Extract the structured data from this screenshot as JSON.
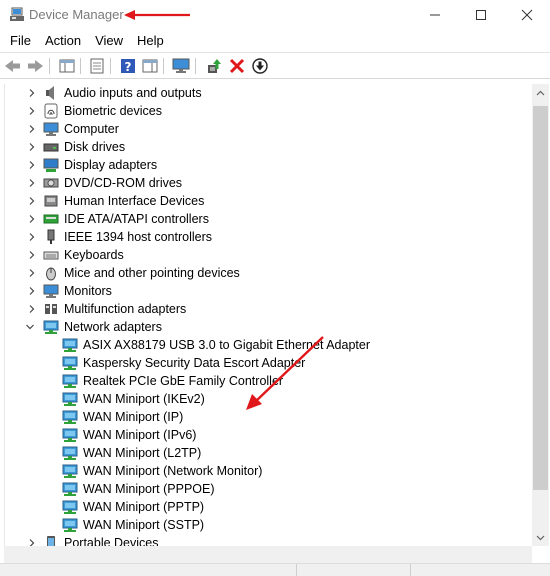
{
  "window": {
    "title": "Device Manager",
    "annotation_arrow_color": "#e0181b"
  },
  "menu": [
    "File",
    "Action",
    "View",
    "Help"
  ],
  "toolbar": {
    "buttons": [
      "back-icon",
      "forward-icon",
      "show-hide-console-tree-icon",
      "properties-icon",
      "help-icon",
      "action-pane-icon",
      "monitor-icon",
      "update-driver-icon",
      "uninstall-icon",
      "download-icon"
    ]
  },
  "tree": {
    "categories_above": [
      {
        "label": "Audio inputs and outputs",
        "icon": "speaker-icon"
      },
      {
        "label": "Biometric devices",
        "icon": "fingerprint-icon"
      },
      {
        "label": "Computer",
        "icon": "computer-icon"
      },
      {
        "label": "Disk drives",
        "icon": "disk-drive-icon"
      },
      {
        "label": "Display adapters",
        "icon": "display-adapter-icon"
      },
      {
        "label": "DVD/CD-ROM drives",
        "icon": "dvd-drive-icon"
      },
      {
        "label": "Human Interface Devices",
        "icon": "hid-icon"
      },
      {
        "label": "IDE ATA/ATAPI controllers",
        "icon": "ide-controller-icon"
      },
      {
        "label": "IEEE 1394 host controllers",
        "icon": "ieee1394-icon"
      },
      {
        "label": "Keyboards",
        "icon": "keyboard-icon"
      },
      {
        "label": "Mice and other pointing devices",
        "icon": "mouse-icon"
      },
      {
        "label": "Monitors",
        "icon": "monitor-icon"
      },
      {
        "label": "Multifunction adapters",
        "icon": "multifunction-icon"
      }
    ],
    "expanded": {
      "label": "Network adapters",
      "icon": "network-adapter-icon",
      "children": [
        "ASIX AX88179 USB 3.0 to Gigabit Ethernet Adapter",
        "Kaspersky Security Data Escort Adapter",
        "Realtek PCIe GbE Family Controller",
        "WAN Miniport (IKEv2)",
        "WAN Miniport (IP)",
        "WAN Miniport (IPv6)",
        "WAN Miniport (L2TP)",
        "WAN Miniport (Network Monitor)",
        "WAN Miniport (PPPOE)",
        "WAN Miniport (PPTP)",
        "WAN Miniport (SSTP)"
      ]
    },
    "categories_below": [
      {
        "label": "Portable Devices",
        "icon": "portable-device-icon"
      }
    ]
  }
}
